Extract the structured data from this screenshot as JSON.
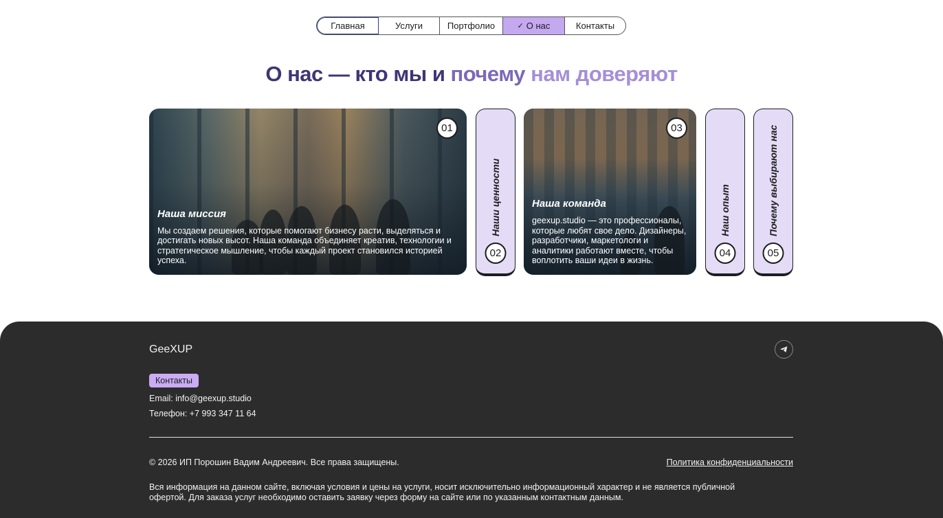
{
  "nav": {
    "items": [
      {
        "label": "Главная"
      },
      {
        "label": "Услуги"
      },
      {
        "label": "Портфолио"
      },
      {
        "label": "О нас",
        "active": true,
        "icon": "check-icon"
      },
      {
        "label": "Контакты"
      }
    ]
  },
  "title": {
    "part1": "О нас — кто мы и ",
    "part2": "почему ",
    "part3": "нам доверяют"
  },
  "cards": [
    {
      "num": "01",
      "title": "Наша миссия",
      "text": "Мы создаем решения, которые помогают бизнесу расти, выделяться и достигать новых высот. Наша команда объединяет креатив, технологии и стратегическое мышление, чтобы каждый проект становился историей успеха."
    },
    {
      "num": "02",
      "title": "Наши ценности"
    },
    {
      "num": "03",
      "title": "Наша команда",
      "text": "geexup.studio — это профессионалы, которые любят свое дело. Дизайнеры, разработчики, маркетологи и аналитики работают вместе, чтобы воплотить ваши идеи в жизнь."
    },
    {
      "num": "04",
      "title": "Наш опыт"
    },
    {
      "num": "05",
      "title": "Почему выбирают нас"
    }
  ],
  "footer": {
    "brand": "GeeXUP",
    "contacts_label": "Контакты",
    "email": "Email: info@geexup.studio",
    "phone": "Телефон: +7 993 347 11 64",
    "copyright": "© 2026 ИП Порошин Вадим Андреевич. Все права защищены.",
    "policy": "Политика конфиденциальности",
    "disclaimer": "Вся информация на данном сайте, включая условия и цены на услуги, носит исключительно информационный характер и не является публичной офертой. Для заказа услуг необходимо оставить заявку через форму на сайте или по указанным контактным данным.",
    "social_icon": "telegram-icon"
  },
  "colors": {
    "accent": "#c4a8f0",
    "tab_bg": "#e4dcf6",
    "footer_bg": "#2c2c2c",
    "title_dark": "#3e3675",
    "title_light": "#a58fd6"
  }
}
